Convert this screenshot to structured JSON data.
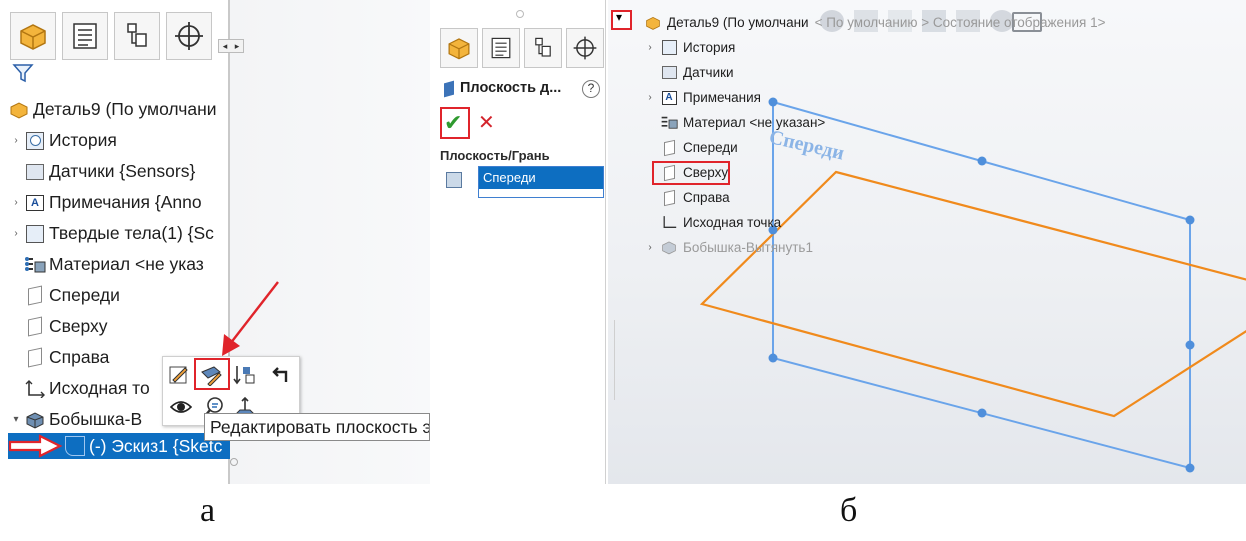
{
  "panel_a": {
    "tabs": [
      "feature-manager-tab",
      "property-manager-tab",
      "configuration-manager-tab",
      "dim-xpert-tab"
    ],
    "tree": [
      {
        "label": "Деталь9 (По умолчани",
        "icon": "part-icon",
        "expander": ""
      },
      {
        "label": "История",
        "icon": "history-icon",
        "expander": "›"
      },
      {
        "label": "Датчики {Sensors}",
        "icon": "sensors-icon",
        "expander": ""
      },
      {
        "label": "Примечания {Anno",
        "icon": "annotations-icon",
        "expander": "›"
      },
      {
        "label": "Твердые тела(1) {Sc",
        "icon": "solid-bodies-icon",
        "expander": "›"
      },
      {
        "label": "Материал <не указ",
        "icon": "material-icon",
        "expander": ""
      },
      {
        "label": "Спереди",
        "icon": "plane-icon",
        "expander": ""
      },
      {
        "label": "Сверху",
        "icon": "plane-icon",
        "expander": ""
      },
      {
        "label": "Справа",
        "icon": "plane-icon",
        "expander": ""
      },
      {
        "label": "Исходная то",
        "icon": "origin-icon",
        "expander": ""
      },
      {
        "label": "Бобышка-В",
        "icon": "boss-extrude-icon",
        "expander": "▾"
      },
      {
        "label": "(-) Эскиз1 {Sketc",
        "icon": "sketch-icon",
        "expander": ""
      }
    ],
    "tooltip": "Редактировать плоскость э",
    "context_toolbar": [
      "edit-sketch-icon",
      "edit-plane-icon",
      "reorder-icon",
      "rollback-icon",
      "show-icon",
      "zoom-to-selection-icon",
      "normal-to-icon"
    ]
  },
  "panel_b": {
    "property_manager": {
      "title": "Плоскость д...",
      "help": "?",
      "ok": "✔",
      "cancel": "✕",
      "section_label": "Плоскость/Грань",
      "selection_item": "Спереди"
    },
    "tree": [
      {
        "label": "Деталь9 (По умолчани",
        "expander": "",
        "icon": "part-icon"
      },
      {
        "label": "История",
        "expander": "›",
        "icon": "history-icon"
      },
      {
        "label": "Датчики",
        "expander": "",
        "icon": "sensors-icon"
      },
      {
        "label": "Примечания",
        "expander": "›",
        "icon": "annotations-icon"
      },
      {
        "label": "Материал <не указан>",
        "expander": "",
        "icon": "material-icon"
      },
      {
        "label": "Спереди",
        "expander": "",
        "icon": "plane-icon"
      },
      {
        "label": "Сверху",
        "expander": "",
        "icon": "plane-icon"
      },
      {
        "label": "Справа",
        "expander": "",
        "icon": "plane-icon"
      },
      {
        "label": "Исходная точка",
        "expander": "",
        "icon": "origin-icon"
      },
      {
        "label": "Бобышка-Вытянуть1",
        "expander": "›",
        "icon": "boss-extrude-icon"
      }
    ],
    "toolbar_text": "< По умолчанию > Состояние отображения 1>",
    "plane_label": "Спереди",
    "dropdown": "▾",
    "colors": {
      "blue_plane": "#6aa4ea",
      "orange_plane": "#f08a1c",
      "selection": "#0d6ec1",
      "red_highlight": "#e0242b"
    }
  },
  "captions": {
    "a": "а",
    "b": "б"
  }
}
